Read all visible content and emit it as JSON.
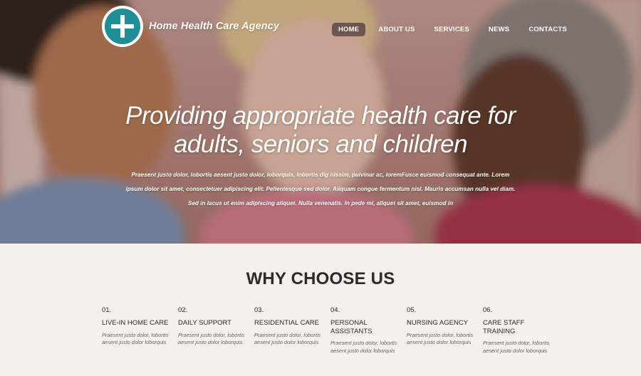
{
  "header": {
    "brand": "Home Health Care Agency",
    "logo_icon": "medical-cross-icon",
    "nav": [
      {
        "label": "HOME",
        "active": true
      },
      {
        "label": "ABOUT US",
        "active": false
      },
      {
        "label": "SERVICES",
        "active": false
      },
      {
        "label": "NEWS",
        "active": false
      },
      {
        "label": "CONTACTS",
        "active": false
      }
    ]
  },
  "hero": {
    "title_line1": "Providing appropriate health care for",
    "title_line2": "adults, seniors and children",
    "text_line1": "Praesent justo dolor, lobortis aesent justo dolor, loborquis, lobortis dig nissim, pulvinar ac, loremFusce euismod consequat ante. Lorem",
    "text_line2": "ipsum dolor sit amet, consectetuer adipiscing elit. Pellentesque sed dolor. Aliquam congue fermentum nisl. Mauris accumsan nulla vel diam.",
    "text_line3": "Sed in lacus ut enim adipiscing aliquet. Nulla venenatis. In pede mi, aliquet sit amet, euismod in"
  },
  "why": {
    "title": "WHY CHOOSE US",
    "features": [
      {
        "num": "01.",
        "name": "LIVE-IN HOME CARE",
        "desc": "Praesent justo dolor, lobortis aesent justo dolor loborquis"
      },
      {
        "num": "02.",
        "name": "DAILY SUPPORT",
        "desc": "Praesent justo dolor, lobortis aesent justo dolor loborquis"
      },
      {
        "num": "03.",
        "name": "RESIDENTIAL CARE",
        "desc": "Praesent justo dolor, lobortis aesent justo dolor loborquis"
      },
      {
        "num": "04.",
        "name": "PERSONAL ASSISTANTS",
        "desc": "Praesent justo dolor, lobortis aesent justo dolor loborquis"
      },
      {
        "num": "05.",
        "name": "NURSING AGENCY",
        "desc": "Praesent justo dolor, lobortis aesent justo dolor loborquis"
      },
      {
        "num": "06.",
        "name": "CARE STAFF TRAINING",
        "desc": "Praesent justo dolor, lobortis aesent justo dolor loborquis"
      }
    ]
  },
  "colors": {
    "accent": "#1f8e95",
    "nav_active_bg": "#5a4444",
    "section_bg": "#f6f0ec",
    "heading": "#2f2a2a"
  }
}
